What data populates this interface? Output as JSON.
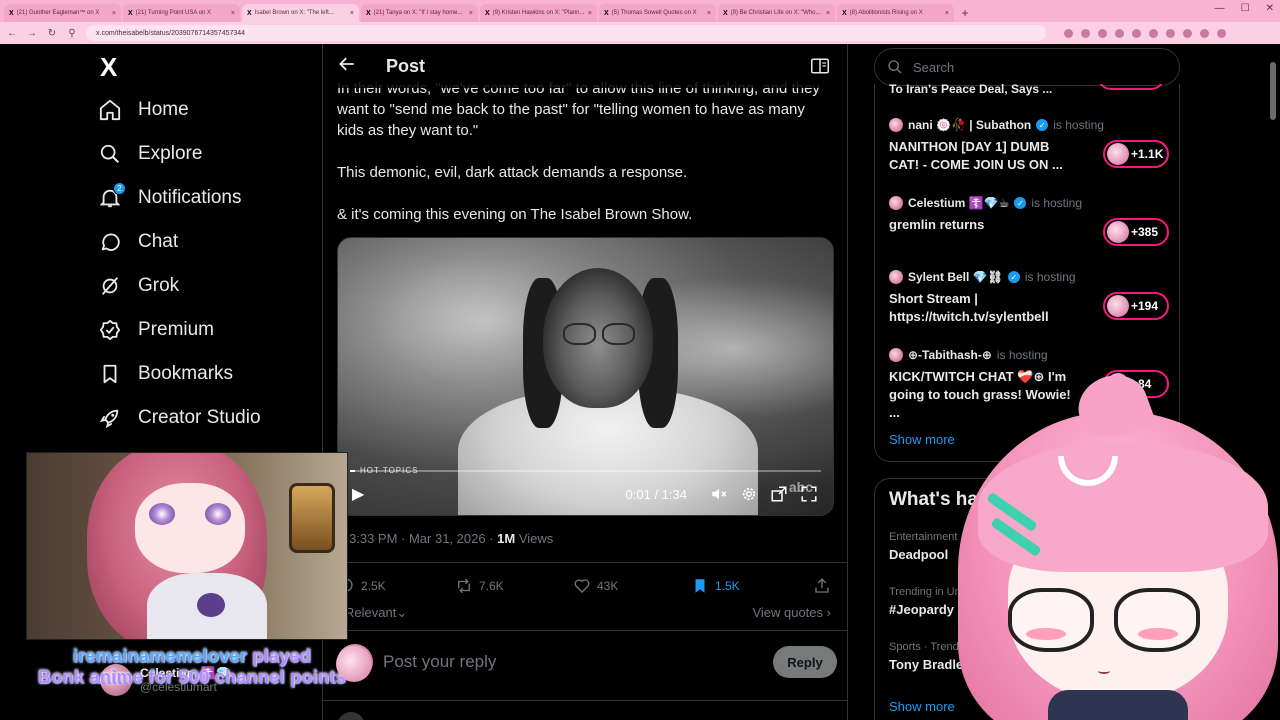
{
  "browser": {
    "tabs": [
      {
        "title": "(21) Gunther Eagleman™ on X",
        "active": false
      },
      {
        "title": "(21) Turning Point USA on X",
        "active": false
      },
      {
        "title": "Isabel Brown on X: \"The left...",
        "active": true
      },
      {
        "title": "(21) Tanya on X: \"If I stay home...",
        "active": false
      },
      {
        "title": "(9) Kristen Hawkins on X: \"Plann...",
        "active": false
      },
      {
        "title": "(5) Thomas Sowell Quotes on X",
        "active": false
      },
      {
        "title": "(9) Be Christian Life on X: \"Who...",
        "active": false
      },
      {
        "title": "(8) Abolitionists Rising on X",
        "active": false
      }
    ],
    "url": "x.com/theisabelb/status/2039076714357457344"
  },
  "sidebar": {
    "logo": "X",
    "items": [
      {
        "label": "Home",
        "icon": "home-icon"
      },
      {
        "label": "Explore",
        "icon": "search-icon"
      },
      {
        "label": "Notifications",
        "icon": "bell-icon",
        "badge": "2"
      },
      {
        "label": "Chat",
        "icon": "chat-icon"
      },
      {
        "label": "Grok",
        "icon": "grok-icon"
      },
      {
        "label": "Premium",
        "icon": "premium-icon"
      },
      {
        "label": "Bookmarks",
        "icon": "bookmark-icon"
      },
      {
        "label": "Creator Studio",
        "icon": "rocket-icon"
      }
    ]
  },
  "main": {
    "header_title": "Post",
    "tweet": {
      "lines": [
        "In their words, \"we've come too far\" to allow this line of thinking, and they want to \"send me back to the past\" for \"telling women to have as many kids as they want to.\"",
        "This demonic, evil, dark attack demands a response.",
        "& it's coming this evening on The Isabel Brown Show."
      ],
      "video": {
        "time": "0:01 / 1:34",
        "progress": 0.01,
        "watermark": "HOT TOPICS",
        "network": "abc"
      },
      "timestamp": "3:33 PM · Mar 31, 2026 · ",
      "views": "1M",
      "views_label": "Views",
      "stats": {
        "replies": "2.5K",
        "reposts": "7.6K",
        "likes": "43K",
        "bookmarks": "1.5K"
      },
      "sort": "Relevant",
      "view_quotes": "View quotes"
    },
    "reply": {
      "placeholder": "Post your reply",
      "button": "Reply"
    }
  },
  "right": {
    "search_placeholder": "Search",
    "live_truncated": "To Iran's Peace Deal, Says ...",
    "live": [
      {
        "host": "nani 🍥🥀 | Subathon",
        "hosting": "is hosting",
        "title": "NANITHON [DAY 1] DUMB CAT! - COME JOIN US ON ...",
        "count": "+1.1K"
      },
      {
        "host": "Celestium ☦️💎☕",
        "hosting": "is hosting",
        "title": "gremlin returns",
        "count": "+385"
      },
      {
        "host": "Sylent Bell 💎⛓",
        "hosting": "is hosting",
        "title": "Short Stream | https://twitch.tv/sylentbell",
        "count": "+194"
      },
      {
        "host": "⊕-Tabithash-⊕",
        "hosting": "is hosting",
        "title": "KICK/TWITCH CHAT ❤️‍🩹⊕ I'm going to touch grass! Wowie! ...",
        "count": "+84"
      }
    ],
    "show_more": "Show more",
    "happening_title": "What's happening",
    "trends": [
      {
        "context": "Entertainment · Trending",
        "name": "Deadpool"
      },
      {
        "context": "Trending in United States",
        "name": "#Jeopardy"
      },
      {
        "context": "Sports · Trending",
        "name": "Tony Bradley"
      }
    ],
    "happening_more": "Show more"
  },
  "overlay": {
    "alert_user": "iremainamemelover",
    "alert_text_1": "played",
    "alert_text_2": "Bonk anime for 500 channel points",
    "ghost_name": "Celestium ☦️💎",
    "ghost_handle": "@celestiumart"
  },
  "colors": {
    "accent": "#1d9bf0",
    "live_pink": "#f91880",
    "browser_pink": "#f7b3d1"
  }
}
